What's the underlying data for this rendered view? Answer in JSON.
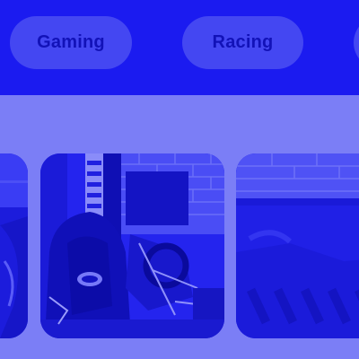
{
  "chips": [
    {
      "label": "Gaming"
    },
    {
      "label": "Racing"
    },
    {
      "label": ""
    }
  ],
  "colors": {
    "chip_bar_bg": "#1b1bf0",
    "chip_bg": "#4447f2",
    "chip_text": "#1212b8",
    "page_bg": "#7b7ef6",
    "photo_tint": "#1f1ff0"
  },
  "carousel": {
    "cards": [
      {
        "subject": "racing-simulator-rig-photo-partial"
      },
      {
        "subject": "racing-simulator-seat-and-wheel-photo"
      },
      {
        "subject": "racing-simulator-cockpit-photo-partial"
      }
    ]
  }
}
